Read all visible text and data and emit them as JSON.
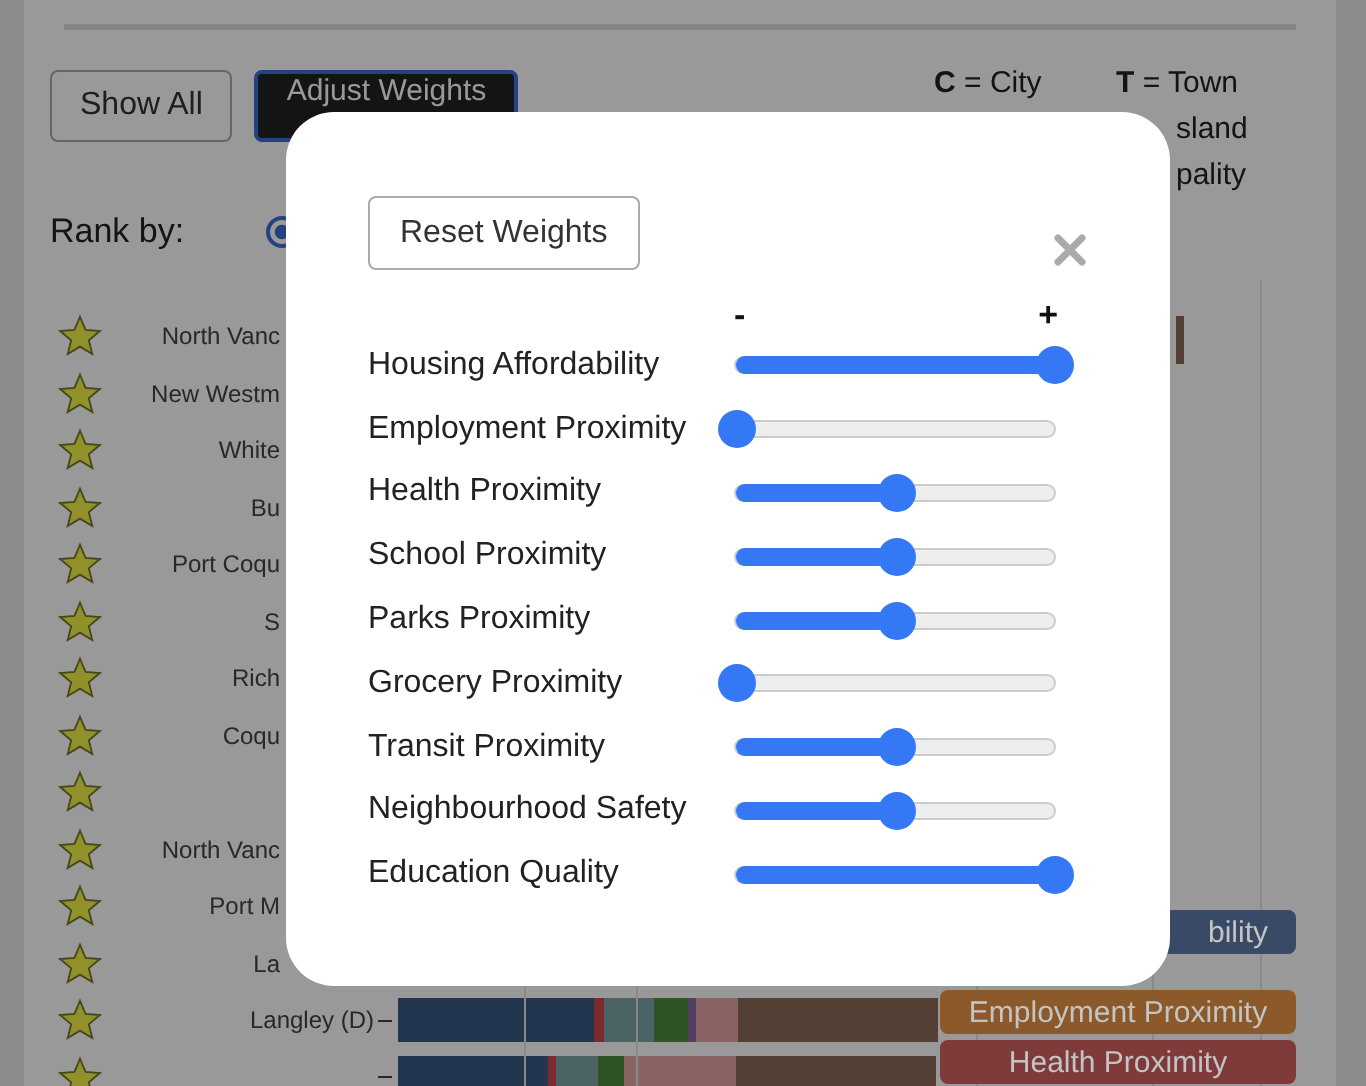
{
  "toolbar": {
    "buttons": [
      {
        "label": "Show All",
        "selected": false
      },
      {
        "label": "Adjust Weights",
        "selected": true
      }
    ]
  },
  "legend": [
    "**C** = City",
    "**T** = Town",
    "sland",
    "pality"
  ],
  "rank_by": {
    "label": "Rank by:",
    "radio_selected": true
  },
  "rows": [
    {
      "name": "North Vanc"
    },
    {
      "name": "New Westm"
    },
    {
      "name": "White"
    },
    {
      "name": "Bu"
    },
    {
      "name": "Port Coqu"
    },
    {
      "name": "S"
    },
    {
      "name": "Rich"
    },
    {
      "name": "Coqu"
    },
    {},
    {
      "name": "North Vanc"
    },
    {
      "name": "Port M"
    },
    {
      "name": "La"
    },
    {
      "name": "Langley (D)"
    },
    {}
  ],
  "chart_legend": [
    {
      "label": "bility",
      "color": "#384a66"
    },
    {
      "label": "Employment Proximity",
      "color": "#8c5a2a"
    },
    {
      "label": "Health Proximity",
      "color": "#7f3a3a"
    }
  ],
  "modal": {
    "reset_button": "Reset Weights",
    "scale_min": "-",
    "scale_max": "+",
    "weights": [
      {
        "label": "Housing Affordability",
        "level": 1
      },
      {
        "label": "Employment Proximity",
        "level": 0
      },
      {
        "label": "Health Proximity",
        "level": 0.5
      },
      {
        "label": "School Proximity",
        "level": 0.5
      },
      {
        "label": "Parks Proximity",
        "level": 0.5
      },
      {
        "label": "Grocery Proximity",
        "level": 0
      },
      {
        "label": "Transit Proximity",
        "level": 0.5
      },
      {
        "label": "Neighbourhood Safety",
        "level": 0.5
      },
      {
        "label": "Education Quality",
        "level": 1
      }
    ]
  }
}
